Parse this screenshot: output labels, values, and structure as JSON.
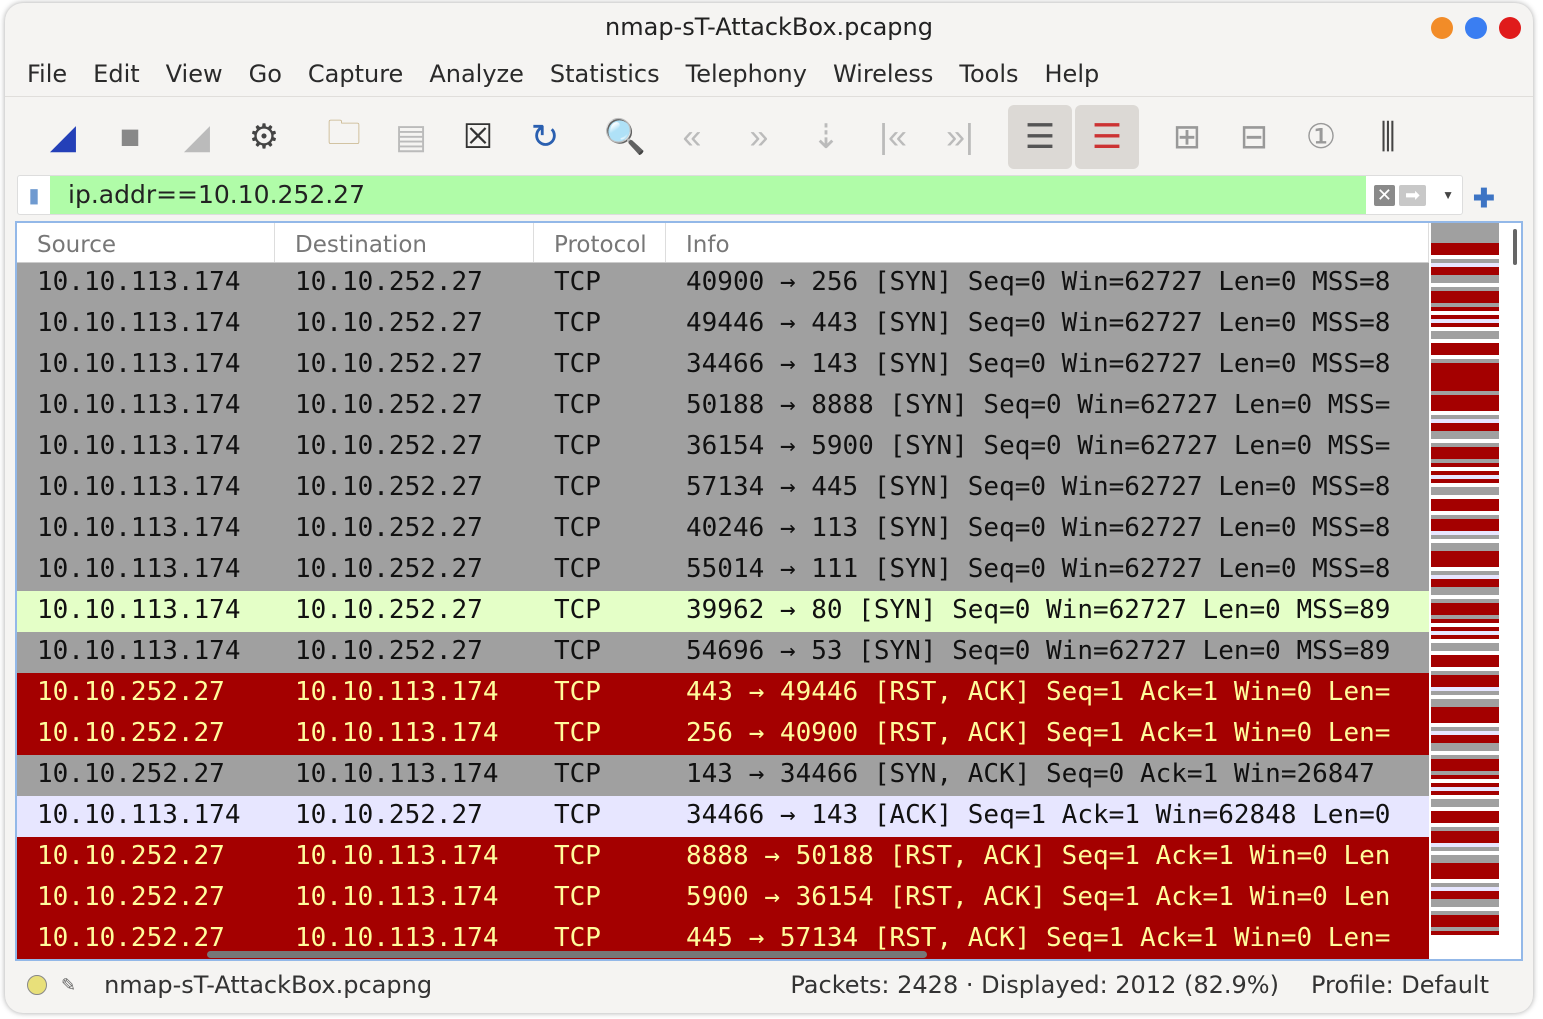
{
  "window": {
    "title": "nmap-sT-AttackBox.pcapng",
    "controls": [
      {
        "name": "minimize",
        "color": "#f28c28"
      },
      {
        "name": "maximize",
        "color": "#3a7ef2"
      },
      {
        "name": "close",
        "color": "#e01b1b"
      }
    ]
  },
  "menu": [
    "File",
    "Edit",
    "View",
    "Go",
    "Capture",
    "Analyze",
    "Statistics",
    "Telephony",
    "Wireless",
    "Tools",
    "Help"
  ],
  "toolbar": [
    {
      "name": "start-capture-icon",
      "glyph": "◢",
      "color": "#2440b8"
    },
    {
      "name": "stop-capture-icon",
      "glyph": "■",
      "color": "#888"
    },
    {
      "name": "restart-capture-icon",
      "glyph": "◢",
      "color": "#bbb"
    },
    {
      "name": "capture-options-icon",
      "glyph": "⚙",
      "color": "#444"
    },
    {
      "name": "open-file-icon",
      "glyph": "🗀",
      "color": "#c8b48a"
    },
    {
      "name": "save-file-icon",
      "glyph": "▤",
      "color": "#bbb"
    },
    {
      "name": "close-file-icon",
      "glyph": "☒",
      "color": "#333"
    },
    {
      "name": "reload-file-icon",
      "glyph": "↻",
      "color": "#2a5fb0"
    },
    {
      "name": "find-packet-icon",
      "glyph": "🔍",
      "color": "#2a4fa8"
    },
    {
      "name": "go-back-icon",
      "glyph": "«",
      "color": "#bbb"
    },
    {
      "name": "go-forward-icon",
      "glyph": "»",
      "color": "#bbb"
    },
    {
      "name": "go-to-packet-icon",
      "glyph": "⇣",
      "color": "#bbb"
    },
    {
      "name": "first-packet-icon",
      "glyph": "|«",
      "color": "#bbb"
    },
    {
      "name": "last-packet-icon",
      "glyph": "»|",
      "color": "#bbb"
    },
    {
      "name": "autoscroll-icon",
      "glyph": "☰",
      "color": "#555",
      "active": true
    },
    {
      "name": "colorize-icon",
      "glyph": "☰",
      "color": "#c33",
      "active": true
    },
    {
      "name": "zoom-in-icon",
      "glyph": "⊞",
      "color": "#999"
    },
    {
      "name": "zoom-out-icon",
      "glyph": "⊟",
      "color": "#999"
    },
    {
      "name": "normal-size-icon",
      "glyph": "①",
      "color": "#999"
    },
    {
      "name": "resize-columns-icon",
      "glyph": "⫼",
      "color": "#444"
    }
  ],
  "filter": {
    "value": "ip.addr==10.10.252.27",
    "bg": "#b0fca8"
  },
  "columns": [
    "Source",
    "Destination",
    "Protocol",
    "Info"
  ],
  "row_styles": {
    "syn": {
      "bg": "#a0a0a0",
      "fg": "#111"
    },
    "http": {
      "bg": "#e4ffc7",
      "fg": "#111"
    },
    "rst": {
      "bg": "#a40000",
      "fg": "#fffc9c"
    },
    "tcp": {
      "bg": "#e7e6ff",
      "fg": "#111"
    }
  },
  "packets": [
    {
      "src": "10.10.113.174",
      "dst": "10.10.252.27",
      "proto": "TCP",
      "info": "40900 → 256 [SYN] Seq=0 Win=62727 Len=0 MSS=8",
      "style": "syn"
    },
    {
      "src": "10.10.113.174",
      "dst": "10.10.252.27",
      "proto": "TCP",
      "info": "49446 → 443 [SYN] Seq=0 Win=62727 Len=0 MSS=8",
      "style": "syn"
    },
    {
      "src": "10.10.113.174",
      "dst": "10.10.252.27",
      "proto": "TCP",
      "info": "34466 → 143 [SYN] Seq=0 Win=62727 Len=0 MSS=8",
      "style": "syn"
    },
    {
      "src": "10.10.113.174",
      "dst": "10.10.252.27",
      "proto": "TCP",
      "info": "50188 → 8888 [SYN] Seq=0 Win=62727 Len=0 MSS=",
      "style": "syn"
    },
    {
      "src": "10.10.113.174",
      "dst": "10.10.252.27",
      "proto": "TCP",
      "info": "36154 → 5900 [SYN] Seq=0 Win=62727 Len=0 MSS=",
      "style": "syn"
    },
    {
      "src": "10.10.113.174",
      "dst": "10.10.252.27",
      "proto": "TCP",
      "info": "57134 → 445 [SYN] Seq=0 Win=62727 Len=0 MSS=8",
      "style": "syn"
    },
    {
      "src": "10.10.113.174",
      "dst": "10.10.252.27",
      "proto": "TCP",
      "info": "40246 → 113 [SYN] Seq=0 Win=62727 Len=0 MSS=8",
      "style": "syn"
    },
    {
      "src": "10.10.113.174",
      "dst": "10.10.252.27",
      "proto": "TCP",
      "info": "55014 → 111 [SYN] Seq=0 Win=62727 Len=0 MSS=8",
      "style": "syn"
    },
    {
      "src": "10.10.113.174",
      "dst": "10.10.252.27",
      "proto": "TCP",
      "info": "39962 → 80 [SYN] Seq=0 Win=62727 Len=0 MSS=89",
      "style": "http"
    },
    {
      "src": "10.10.113.174",
      "dst": "10.10.252.27",
      "proto": "TCP",
      "info": "54696 → 53 [SYN] Seq=0 Win=62727 Len=0 MSS=89",
      "style": "syn"
    },
    {
      "src": "10.10.252.27",
      "dst": "10.10.113.174",
      "proto": "TCP",
      "info": "443 → 49446 [RST, ACK] Seq=1 Ack=1 Win=0 Len=",
      "style": "rst"
    },
    {
      "src": "10.10.252.27",
      "dst": "10.10.113.174",
      "proto": "TCP",
      "info": "256 → 40900 [RST, ACK] Seq=1 Ack=1 Win=0 Len=",
      "style": "rst"
    },
    {
      "src": "10.10.252.27",
      "dst": "10.10.113.174",
      "proto": "TCP",
      "info": "143 → 34466 [SYN, ACK] Seq=0 Ack=1 Win=26847",
      "style": "syn"
    },
    {
      "src": "10.10.113.174",
      "dst": "10.10.252.27",
      "proto": "TCP",
      "info": "34466 → 143 [ACK] Seq=1 Ack=1 Win=62848 Len=0",
      "style": "tcp"
    },
    {
      "src": "10.10.252.27",
      "dst": "10.10.113.174",
      "proto": "TCP",
      "info": "8888 → 50188 [RST, ACK] Seq=1 Ack=1 Win=0 Len",
      "style": "rst"
    },
    {
      "src": "10.10.252.27",
      "dst": "10.10.113.174",
      "proto": "TCP",
      "info": "5900 → 36154 [RST, ACK] Seq=1 Ack=1 Win=0 Len",
      "style": "rst"
    },
    {
      "src": "10.10.252.27",
      "dst": "10.10.113.174",
      "proto": "TCP",
      "info": "445 → 57134 [RST, ACK] Seq=1 Ack=1 Win=0 Len=",
      "style": "rst"
    }
  ],
  "status": {
    "file": "nmap-sT-AttackBox.pcapng",
    "packets": "Packets: 2428 · Displayed: 2012 (82.9%)",
    "profile": "Profile: Default"
  }
}
